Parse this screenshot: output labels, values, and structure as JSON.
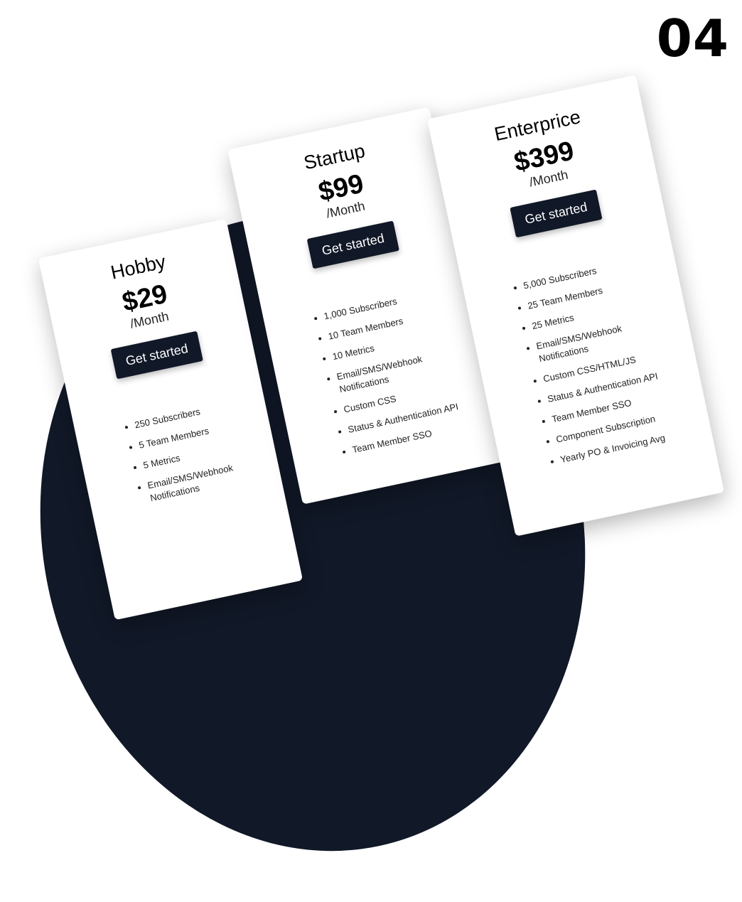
{
  "page_number": "04",
  "colors": {
    "dark": "#111827",
    "background": "#ffffff"
  },
  "plans": [
    {
      "name": "Hobby",
      "price": "$29",
      "period": "/Month",
      "cta": "Get started",
      "features": [
        "250 Subscribers",
        "5 Team Members",
        "5 Metrics",
        "Email/SMS/Webhook Notifications"
      ]
    },
    {
      "name": "Startup",
      "price": "$99",
      "period": "/Month",
      "cta": "Get started",
      "features": [
        "1,000 Subscribers",
        "10 Team Members",
        "10 Metrics",
        "Email/SMS/Webhook Notifications",
        "Custom CSS",
        "Status & Authentication API",
        "Team Member SSO"
      ]
    },
    {
      "name": "Enterprice",
      "price": "$399",
      "period": "/Month",
      "cta": "Get started",
      "features": [
        "5,000 Subscribers",
        "25 Team Members",
        "25 Metrics",
        "Email/SMS/Webhook Notifications",
        "Custom CSS/HTML/JS",
        "Status & Authentication API",
        "Team Member SSO",
        "Component Subscription",
        "Yearly PO & Invoicing Avg"
      ]
    }
  ]
}
